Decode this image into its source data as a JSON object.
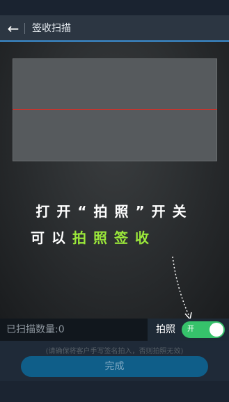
{
  "header": {
    "back_icon": "←",
    "title": "签收扫描"
  },
  "overlay_hint": {
    "line1": "打开“拍照”开关",
    "line2_prefix": "可以",
    "line2_highlight": "拍照签收"
  },
  "bottom_bar": {
    "count_label": "已扫描数量:0",
    "photo_label": "拍照",
    "toggle_state_text": "开"
  },
  "note": "(请确保将客户手写签名拍入，否则拍照无效)",
  "done_button": "完成",
  "colors": {
    "accent_blue": "#3b8dd0",
    "highlight_green": "#9be83a",
    "toggle_green": "#36c26b",
    "button_blue": "#0f5e89",
    "scan_line_red": "#c8342d"
  }
}
